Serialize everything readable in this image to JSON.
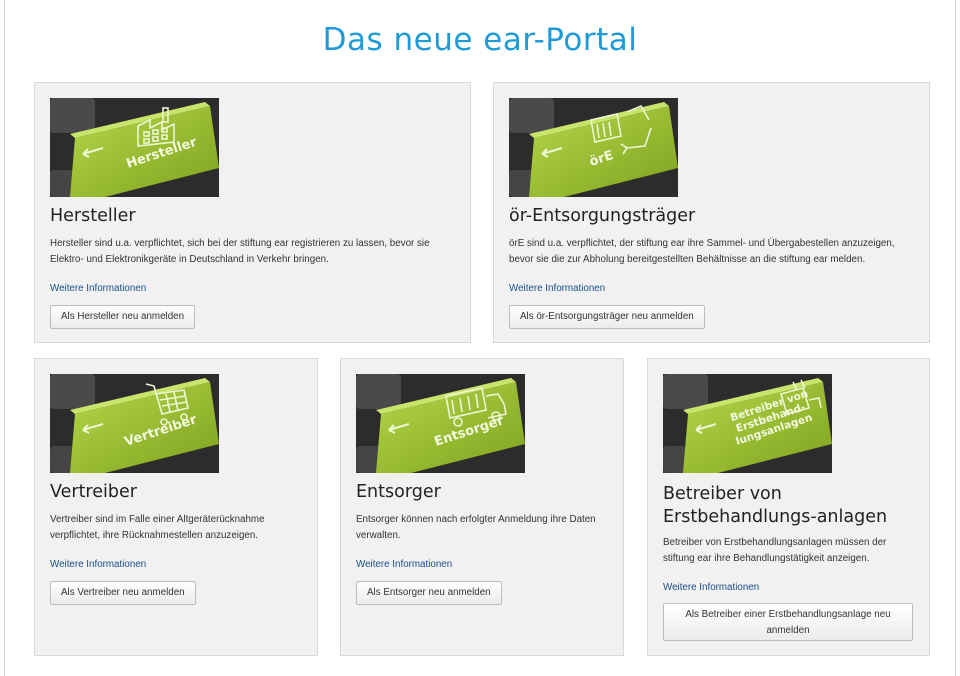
{
  "page": {
    "title": "Das neue ear-Portal"
  },
  "colors": {
    "title": "#1f9bd7",
    "link": "#1a4f8b",
    "key_green": "#8fb82c"
  },
  "cards": {
    "hersteller": {
      "image_label": "Hersteller",
      "heading": "Hersteller",
      "text": "Hersteller sind u.a. verpflichtet, sich bei der stiftung ear registrieren zu lassen, bevor sie Elektro- und Elektronikgeräte in Deutschland in Verkehr bringen.",
      "link": "Weitere Informationen",
      "button": "Als Hersteller neu anmelden",
      "icon": "factory-icon"
    },
    "oere": {
      "image_label": "örE",
      "heading": "ör-Entsorgungsträger",
      "text": "örE sind u.a. verpflichtet, der stiftung ear ihre Sammel- und Übergabestellen anzuzeigen, bevor sie die zur Abholung bereitgestellten Behältnisse an die stiftung ear melden.",
      "link": "Weitere Informationen",
      "button": "Als ör-Entsorgungsträger neu anmelden",
      "icon": "recycling-icon"
    },
    "vertreiber": {
      "image_label": "Vertreiber",
      "heading": "Vertreiber",
      "text": "Vertreiber sind im Falle einer Altgeräterücknahme verpflichtet, ihre Rücknahmestellen anzuzeigen.",
      "link": "Weitere Informationen",
      "button": "Als Vertreiber neu anmelden",
      "icon": "shopping-cart-icon"
    },
    "entsorger": {
      "image_label": "Entsorger",
      "heading": "Entsorger",
      "text": "Entsorger können nach erfolgter Anmeldung ihre Daten verwalten.",
      "link": "Weitere Informationen",
      "button": "Als Entsorger neu anmelden",
      "icon": "truck-icon"
    },
    "betreiber": {
      "image_label_lines": [
        "Betreiber von",
        "Erstbehand-",
        "lungsanlagen"
      ],
      "heading": "Betreiber von Erstbehandlungs-anlagen",
      "text": "Betreiber von Erstbehandlungsanlagen müssen der stiftung ear ihre Behandlungstätigkeit anzeigen.",
      "link": "Weitere Informationen",
      "button": "Als Betreiber einer Erstbehandlungsanlage neu anmelden",
      "icon": "treatment-plant-icon"
    }
  }
}
